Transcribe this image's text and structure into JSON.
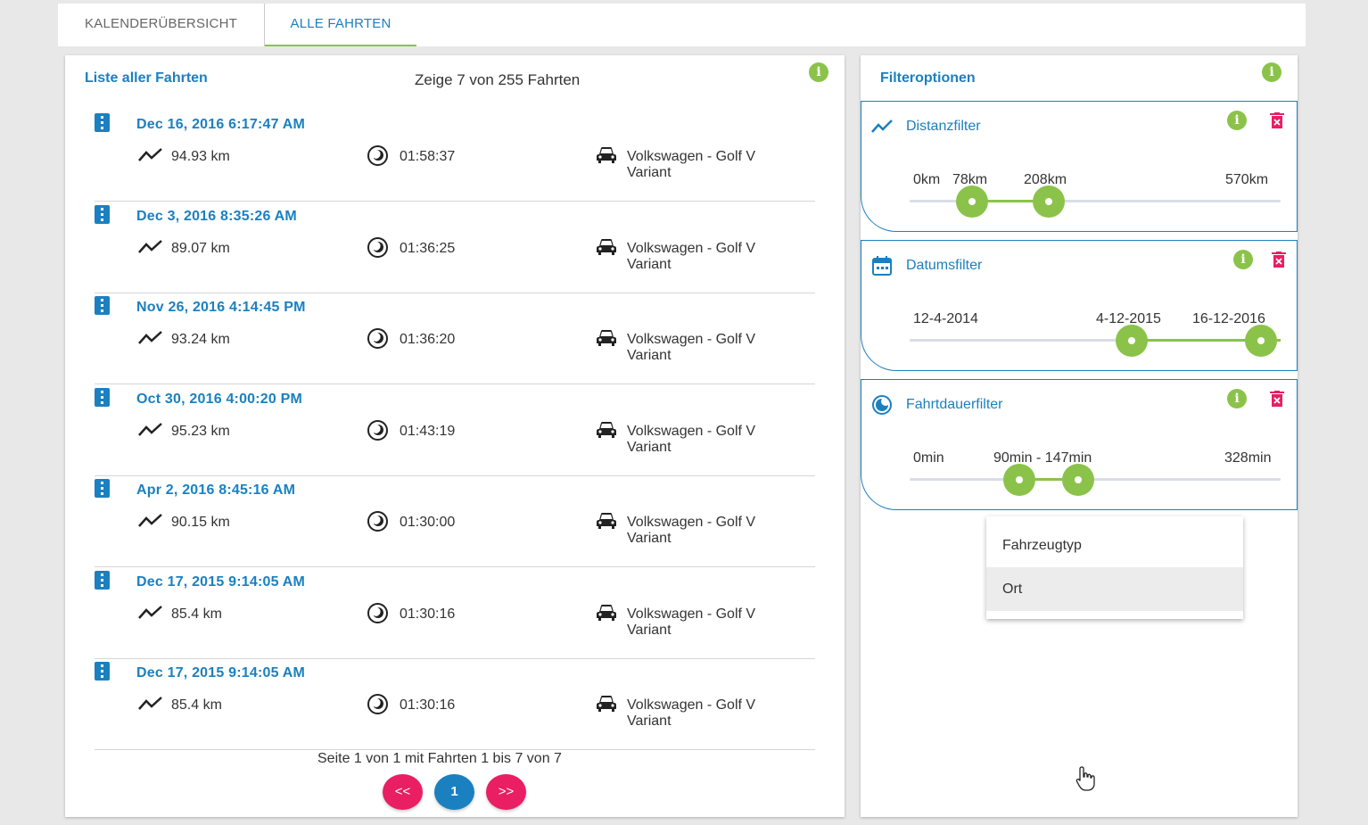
{
  "tabs": [
    {
      "label": "KALENDERÜBERSICHT",
      "active": false
    },
    {
      "label": "ALLE FAHRTEN",
      "active": true
    }
  ],
  "trips_panel": {
    "title": "Liste aller Fahrten",
    "summary": "Zeige 7 von 255 Fahrten",
    "info_icon": "i"
  },
  "trips": [
    {
      "date": "Dec 16, 2016 6:17:47 AM",
      "distance": "94.93 km",
      "duration": "01:58:37",
      "vehicle": "Volkswagen - Golf V Variant"
    },
    {
      "date": "Dec 3, 2016 8:35:26 AM",
      "distance": "89.07 km",
      "duration": "01:36:25",
      "vehicle": "Volkswagen - Golf V Variant"
    },
    {
      "date": "Nov 26, 2016 4:14:45 PM",
      "distance": "93.24 km",
      "duration": "01:36:20",
      "vehicle": "Volkswagen - Golf V Variant"
    },
    {
      "date": "Oct 30, 2016 4:00:20 PM",
      "distance": "95.23 km",
      "duration": "01:43:19",
      "vehicle": "Volkswagen - Golf V Variant"
    },
    {
      "date": "Apr 2, 2016 8:45:16 AM",
      "distance": "90.15 km",
      "duration": "01:30:00",
      "vehicle": "Volkswagen - Golf V Variant"
    },
    {
      "date": "Dec 17, 2015 9:14:05 AM",
      "distance": "85.4 km",
      "duration": "01:30:16",
      "vehicle": "Volkswagen - Golf V Variant"
    },
    {
      "date": "Dec 17, 2015 9:14:05 AM",
      "distance": "85.4 km",
      "duration": "01:30:16",
      "vehicle": "Volkswagen - Golf V Variant"
    }
  ],
  "pagination": {
    "text": "Seite 1 von 1 mit Fahrten 1 bis 7 von 7",
    "prev": "<<",
    "current": "1",
    "next": ">>"
  },
  "filters_panel": {
    "title": "Filteroptionen",
    "info_icon": "i",
    "filters": [
      {
        "name": "Distanzfilter",
        "min_label": "0km",
        "low_label": "78km",
        "high_label": "208km",
        "max_label": "570km",
        "range_start": 78,
        "range_end": 208,
        "min": 0,
        "max": 570,
        "unit": "km"
      },
      {
        "name": "Datumsfilter",
        "min_label": "12-4-2014",
        "low_label": "4-12-2015",
        "high_label": "16-12-2016",
        "range_start": "2015-12-04",
        "range_end": "2016-12-16",
        "min": "2014-04-12",
        "max": "2016-12-16"
      },
      {
        "name": "Fahrtdauerfilter",
        "min_label": "0min",
        "range_label": "90min - 147min",
        "max_label": "328min",
        "range_start": 90,
        "range_end": 147,
        "min": 0,
        "max": 328,
        "unit": "min"
      }
    ],
    "menu": [
      {
        "label": "Fahrzeugtyp",
        "highlighted": false
      },
      {
        "label": "Ort",
        "highlighted": true
      }
    ]
  },
  "colors": {
    "primary": "#1b80c0",
    "accent_green": "#8bc34a",
    "danger_pink": "#e91e63",
    "track": "#d8dde8"
  }
}
